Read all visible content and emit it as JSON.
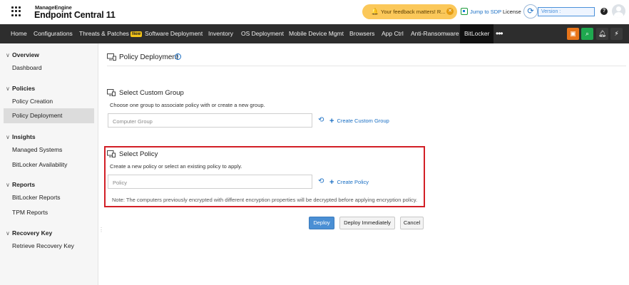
{
  "header": {
    "brand_top": "ManageEngine",
    "brand_name": "Endpoint Central 11",
    "feedback_text": "Your feedback matters! R...",
    "jump_sdp": "Jump to SDP",
    "license": "License",
    "version_label": "Version :",
    "help": "?"
  },
  "nav": {
    "items": [
      "Home",
      "Configurations",
      "Threats & Patches",
      "Software Deployment",
      "Inventory",
      "OS Deployment",
      "Mobile Device Mgmt",
      "Browsers",
      "App Ctrl",
      "Anti-Ransomware",
      "BitLocker"
    ],
    "new_badge": "New",
    "more": "•••",
    "active": "BitLocker"
  },
  "sidebar": {
    "sections": [
      {
        "title": "Overview",
        "items": [
          "Dashboard"
        ]
      },
      {
        "title": "Policies",
        "items": [
          "Policy Creation",
          "Policy Deployment"
        ]
      },
      {
        "title": "Insights",
        "items": [
          "Managed Systems",
          "BitLocker Availability"
        ]
      },
      {
        "title": "Reports",
        "items": [
          "BitLocker Reports",
          "TPM Reports"
        ]
      },
      {
        "title": "Recovery Key",
        "items": [
          "Retrieve Recovery Key"
        ]
      }
    ],
    "active_item": "Policy Deployment"
  },
  "main": {
    "page_title": "Policy Deployment",
    "custom_group": {
      "title": "Select Custom Group",
      "description": "Choose one group to associate policy with or create a new group.",
      "placeholder": "Computer Group",
      "create_label": "Create Custom Group"
    },
    "policy": {
      "title": "Select Policy",
      "description": "Create a new policy or select an existing policy to apply.",
      "placeholder": "Policy",
      "create_label": "Create Policy",
      "note": "Note: The computers previously encrypted with different encryption properties will be decrypted before applying encryption policy."
    },
    "buttons": {
      "deploy": "Deploy",
      "deploy_immediately": "Deploy Immediately",
      "cancel": "Cancel"
    }
  },
  "colors": {
    "nav_bg": "#2d2d2d",
    "accent_blue": "#1a6fc4",
    "feedback_bg": "#fbc85a",
    "highlight_red": "#d21f26",
    "btn_orange": "#e8751a",
    "btn_green": "#1fa84f",
    "btn_dark": "#3a3a3a"
  }
}
